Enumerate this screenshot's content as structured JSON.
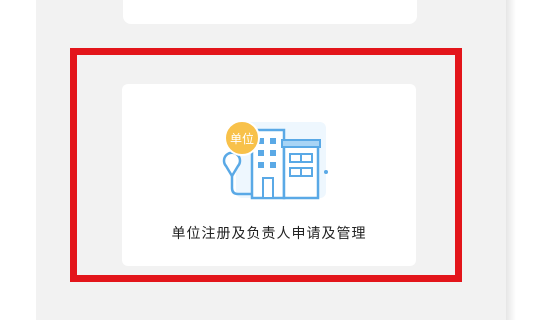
{
  "card": {
    "badge_text": "单位",
    "label": "单位注册及负责人申请及管理",
    "icon": "building-with-location-pin-icon"
  },
  "colors": {
    "highlight_border": "#e3151b",
    "badge_bg": "#f8c14a",
    "illustration_blue": "#5aa9e6",
    "illustration_light_blue": "#e6f3fd",
    "panel_bg": "#f2f2f2"
  }
}
